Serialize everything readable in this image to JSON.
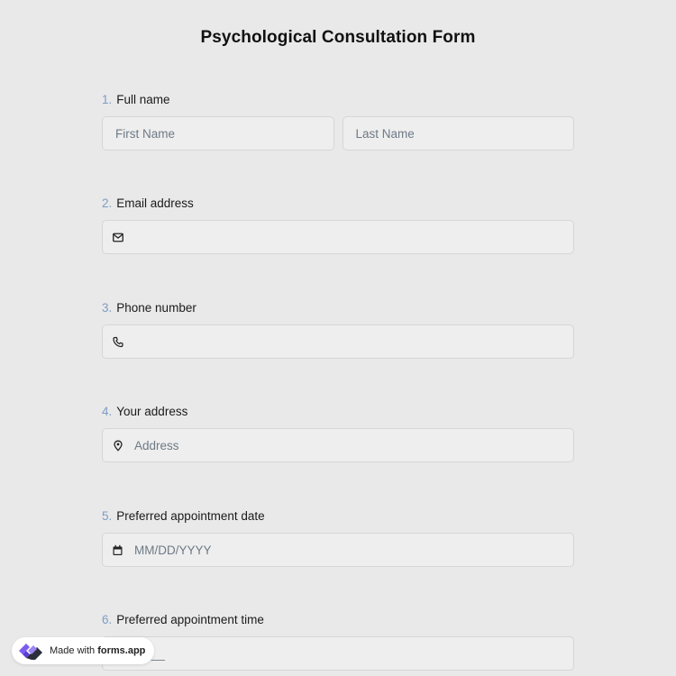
{
  "form": {
    "title": "Psychological Consultation Form"
  },
  "questions": {
    "q1": {
      "number": "1.",
      "label": "Full name",
      "first_placeholder": "First Name",
      "last_placeholder": "Last Name"
    },
    "q2": {
      "number": "2.",
      "label": "Email address",
      "placeholder": "",
      "icon": "envelope-icon"
    },
    "q3": {
      "number": "3.",
      "label": "Phone number",
      "placeholder": "",
      "icon": "phone-icon"
    },
    "q4": {
      "number": "4.",
      "label": "Your address",
      "placeholder": "Address",
      "icon": "map-pin-icon"
    },
    "q5": {
      "number": "5.",
      "label": "Preferred appointment date",
      "placeholder": "MM/DD/YYYY",
      "icon": "calendar-icon"
    },
    "q6": {
      "number": "6.",
      "label": "Preferred appointment time",
      "placeholder": "__:__",
      "icon": "clock-icon"
    }
  },
  "badge": {
    "prefix": "Made with",
    "brand": "forms.app"
  },
  "colors": {
    "background": "#e9e9e9",
    "field_background": "#eeeeee",
    "question_number": "#7f9cc4",
    "placeholder": "#6e7a86",
    "logo_purple": "#7b5cf0",
    "logo_dark": "#2b2f3a"
  }
}
